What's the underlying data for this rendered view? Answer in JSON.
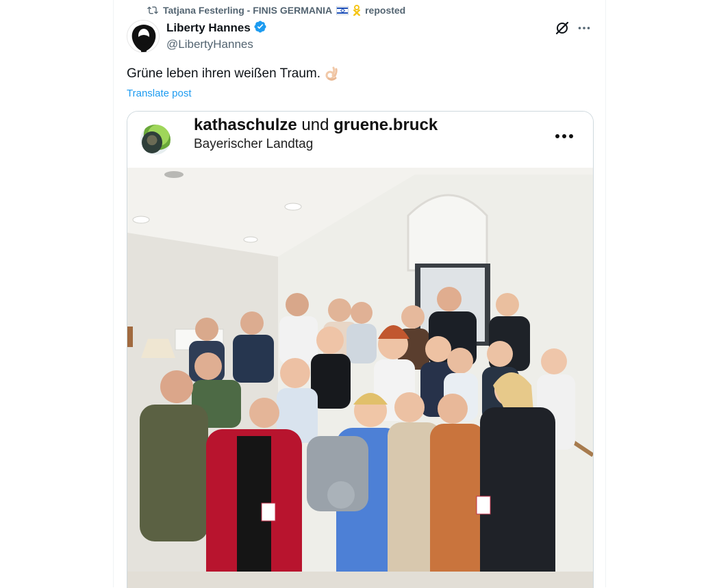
{
  "repost": {
    "icon": "repost-icon",
    "user_name": "Tatjana Festerling - FINIS GERMANIA",
    "suffix": "reposted"
  },
  "author": {
    "name": "Liberty Hannes",
    "handle": "@LibertyHannes",
    "verified": true
  },
  "post": {
    "text": "Grüne leben ihren weißen Traum.",
    "emoji": "ok-hand-emoji",
    "translate_label": "Translate post"
  },
  "embedded_post": {
    "account_1": "kathaschulze",
    "connector": "und",
    "account_2": "gruene.bruck",
    "location": "Bayerischer Landtag"
  },
  "colors": {
    "link": "#1d9bf0",
    "verified": "#1d9bf0",
    "muted": "#536471",
    "text": "#0f1419"
  }
}
